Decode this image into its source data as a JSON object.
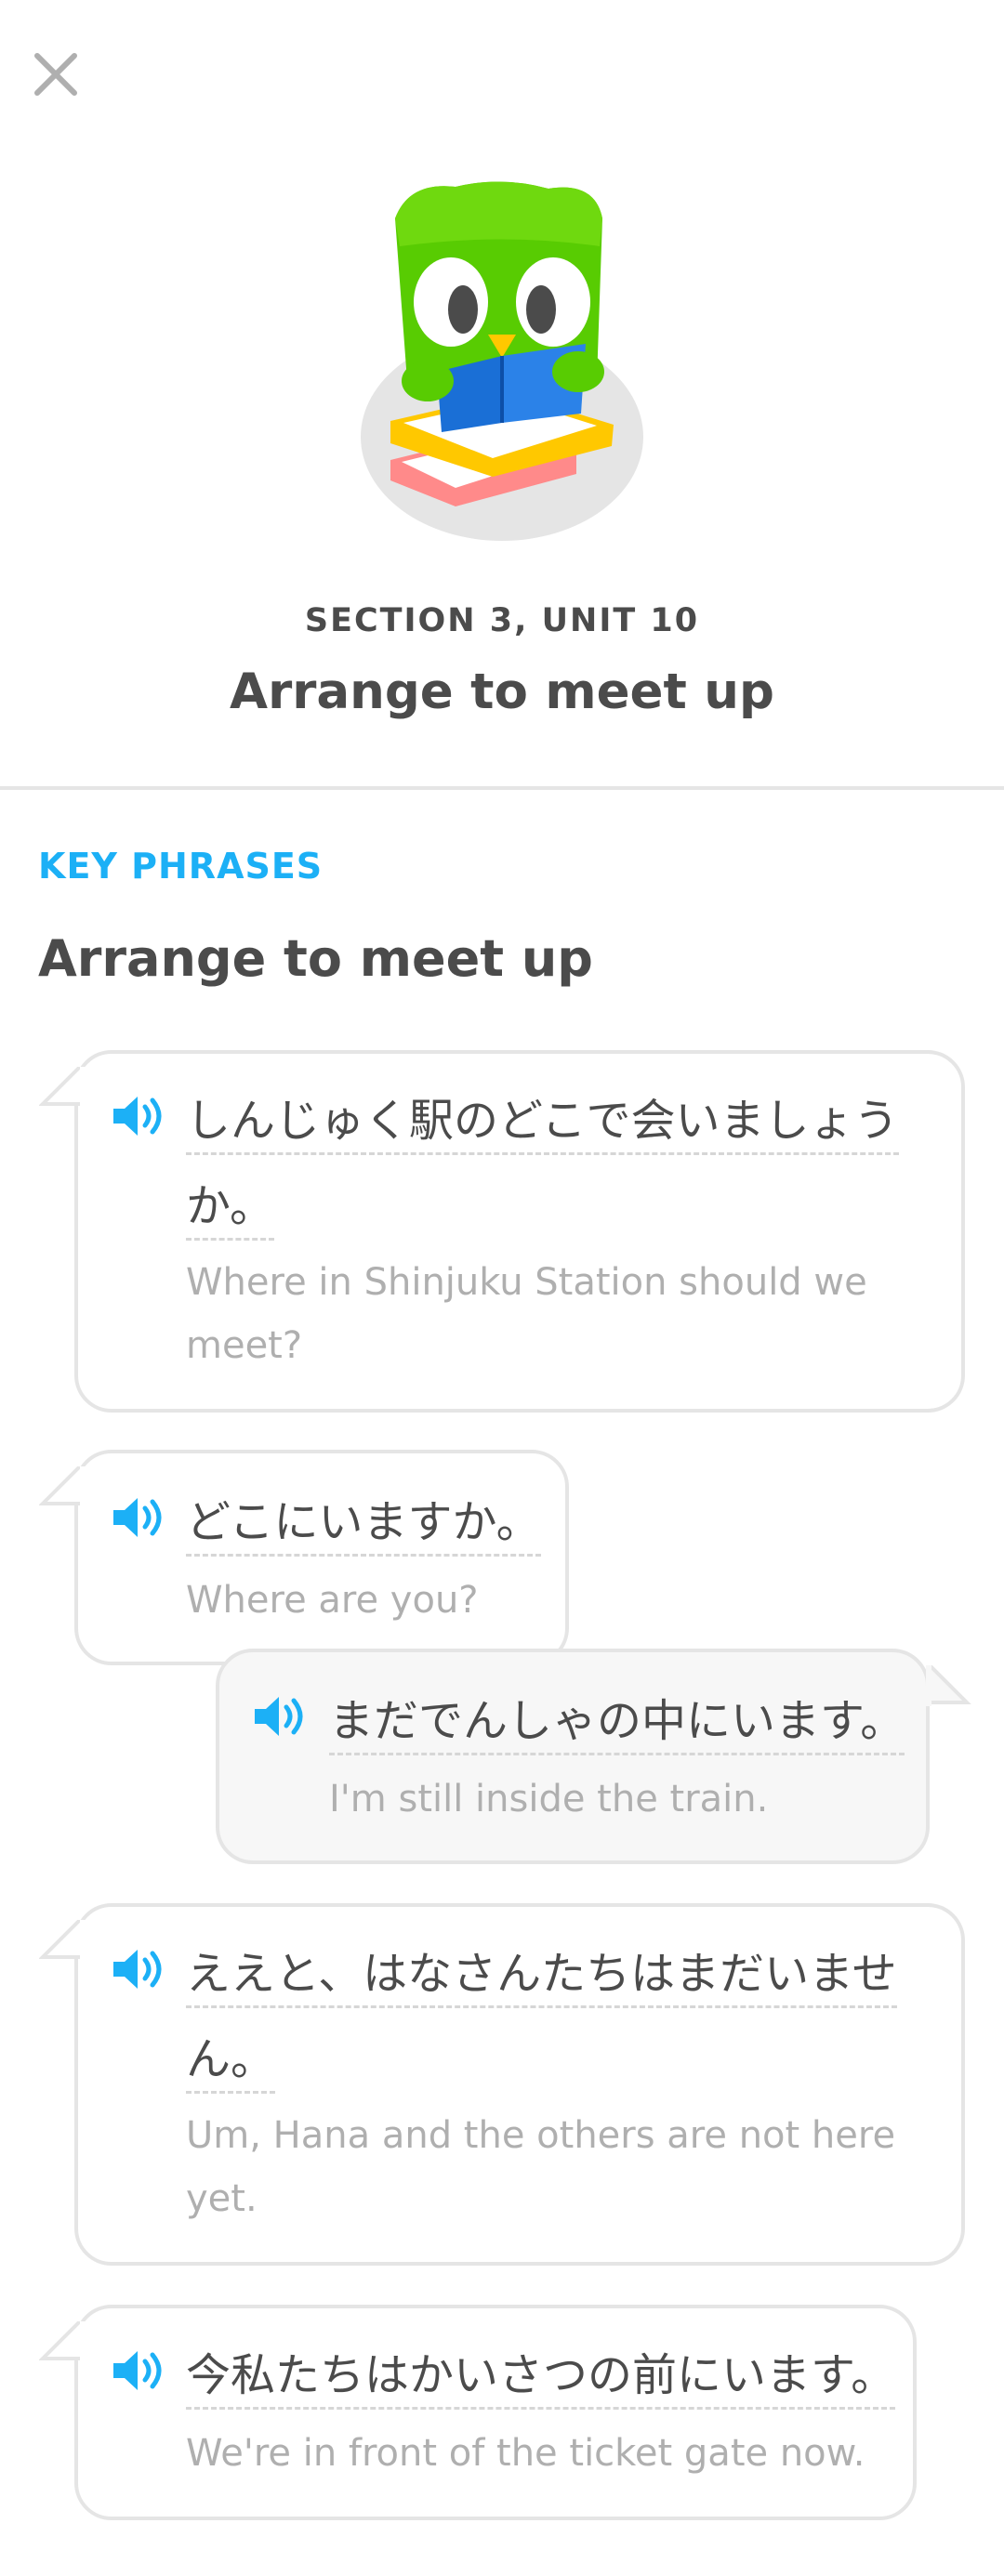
{
  "header": {
    "section_label": "SECTION 3, UNIT 10",
    "unit_title": "Arrange to meet up"
  },
  "key_phrases": {
    "label": "KEY PHRASES",
    "title": "Arrange to meet up"
  },
  "phrases": [
    {
      "jp_line1": "しんじゅく駅のどこで会いましょう",
      "jp_line2": "か。",
      "en_line1": "Where in Shinjuku Station should we",
      "en_line2": "meet?",
      "speaker": "left"
    },
    {
      "jp_line1": "どこにいますか。",
      "en_line1": "Where are you?",
      "speaker": "left"
    },
    {
      "jp_line1": "まだでんしゃの中にいます。",
      "en_line1": "I'm still inside the train.",
      "speaker": "right"
    },
    {
      "jp_line1": "ええと、はなさんたちはまだいませ",
      "jp_line2": "ん。",
      "en_line1": "Um, Hana and the others are not here",
      "en_line2": "yet.",
      "speaker": "left"
    },
    {
      "jp_line1": "今私たちはかいさつの前にいます。",
      "en_line1": "We're in front of the ticket gate now.",
      "speaker": "left"
    }
  ],
  "icons": {
    "close": "close-icon",
    "speaker": "speaker-icon",
    "mascot": "owl-reading-book-illustration"
  },
  "colors": {
    "accent_blue": "#1cb0f6",
    "text_dark": "#4b4b4b",
    "text_muted": "#afafaf",
    "border": "#e5e5e5",
    "owl_green": "#58cc02"
  }
}
